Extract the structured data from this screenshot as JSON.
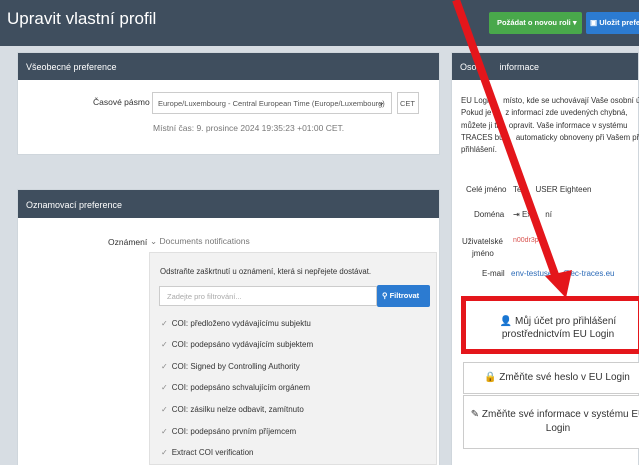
{
  "header": {
    "title": "Upravit vlastní profil",
    "request_role_label": "Požádat o novou roli",
    "save_label": "Uložit prefere"
  },
  "general_prefs": {
    "heading": "Všeobecné preference",
    "timezone_label": "Časové pásmo",
    "timezone_value": "Europe/Luxembourg - Central European Time (Europe/Luxembourg)",
    "timezone_abbr": "CET",
    "local_time": "Místní čas: 9. prosince 2024 19:35:23 +01:00 CET."
  },
  "notification_prefs": {
    "heading": "Oznamovací preference",
    "notifications_label": "Oznámení",
    "group_label": "Documents notifications",
    "instruction": "Odstraňte zaškrtnutí u oznámení, která si nepřejete dostávat.",
    "filter_placeholder": "Zadejte pro filtrování...",
    "filter_button": "Filtrovat",
    "items": [
      "COI: předloženo vydávajícímu subjektu",
      "COI: podepsáno vydávajícím subjektem",
      "COI: Signed by Controlling Authority",
      "COI: podepsáno schvalujícím orgánem",
      "COI: zásilku nelze odbavit, zamítnuto",
      "COI: podepsáno prvním příjemcem",
      "Extract COI verification"
    ]
  },
  "personal_info": {
    "heading_part1": "Osob",
    "heading_part2": "informace",
    "description_lines": [
      "EU Login",
      "Pokud je",
      "můžete ji ta",
      "TRACES bud",
      "přihlášení."
    ],
    "description_tails": [
      "místo, kde se uchovávají Vaše osobní úd",
      "z informací zde uvedených chybná,",
      "opravit. Vaše informace v systému",
      "automaticky obnoveny při Vašem přís",
      ""
    ],
    "full_name_label": "Celé jméno",
    "full_name_value_part1": "Tes",
    "full_name_value_part2": "USER Eighteen",
    "domain_label": "Doména",
    "domain_value_part1": "Ex",
    "domain_value_part2": "ní",
    "username_label_line1": "Uživatelské",
    "username_label_line2": "jméno",
    "username_value": "n00dr3p",
    "email_label": "E-mail",
    "email_value_part1": "env-testuse",
    "email_value_part2": "@ec-traces.eu",
    "eulogin_account_line1": "Můj účet pro přihlášení",
    "eulogin_account_line2": "prostřednictvím EU Login",
    "change_password": "Změňte své heslo v EU Login",
    "change_info_line1": "Změňte své informace v systému EU",
    "change_info_line2": "Login"
  },
  "colors": {
    "header_bg": "#3f4e5e",
    "primary_blue": "#2c7bd1",
    "success_green": "#49a84b",
    "annotation_red": "#e4161b"
  }
}
